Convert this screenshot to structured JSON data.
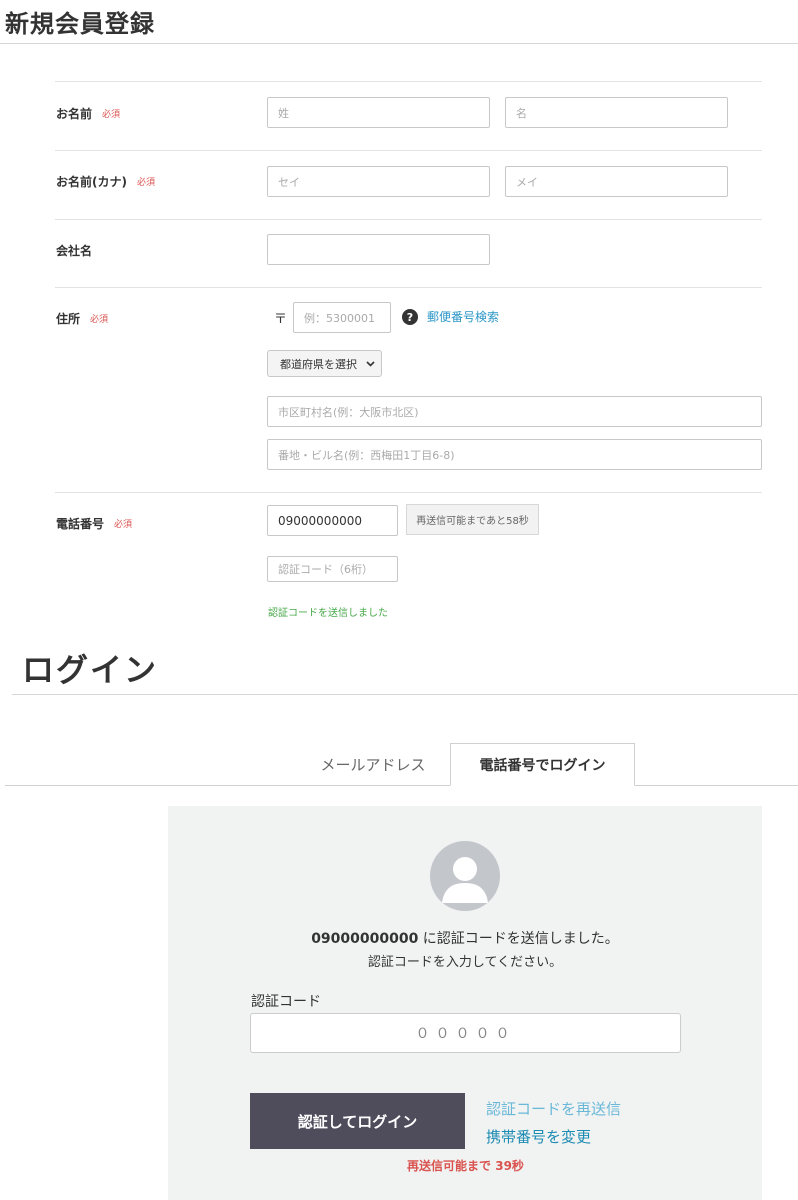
{
  "registration": {
    "title": "新規会員登録",
    "required_badge": "必須",
    "name": {
      "label": "お名前",
      "last_placeholder": "姓",
      "first_placeholder": "名"
    },
    "kana": {
      "label": "お名前(カナ)",
      "last_placeholder": "セイ",
      "first_placeholder": "メイ"
    },
    "company": {
      "label": "会社名",
      "value": ""
    },
    "address": {
      "label": "住所",
      "postal_mark": "〒",
      "postal_placeholder": "例：5300001",
      "help_icon": "question-circle-icon",
      "postal_search_link": "郵便番号検索",
      "prefecture_select": "都道府県を選択",
      "city_placeholder": "市区町村名(例：大阪市北区)",
      "street_placeholder": "番地・ビル名(例：西梅田1丁目6-8)"
    },
    "phone": {
      "label": "電話番号",
      "value": "09000000000",
      "resend_status": "再送信可能まであと58秒",
      "code_placeholder": "認証コード（6桁）",
      "sent_message": "認証コードを送信しました"
    }
  },
  "login": {
    "title": "ログイン",
    "tabs": [
      {
        "label": "メールアドレス",
        "active": false
      },
      {
        "label": "電話番号でログイン",
        "active": true
      }
    ],
    "avatar_icon": "user-avatar-icon",
    "phone_number": "09000000000",
    "sent_text": " に認証コードを送信しました。",
    "instruction": "認証コードを入力してください。",
    "code_label": "認証コード",
    "code_placeholder": "０００００",
    "submit_button": "認証してログイン",
    "resend_link": "認証コードを再送信",
    "change_number_link": "携帯番号を変更",
    "countdown": "再送信可能まで 39秒"
  },
  "colors": {
    "required": "#d9534f",
    "link": "#2b96c7",
    "success": "#48a84a",
    "button": "#4f4c5c",
    "panel": "#f1f2f2"
  }
}
